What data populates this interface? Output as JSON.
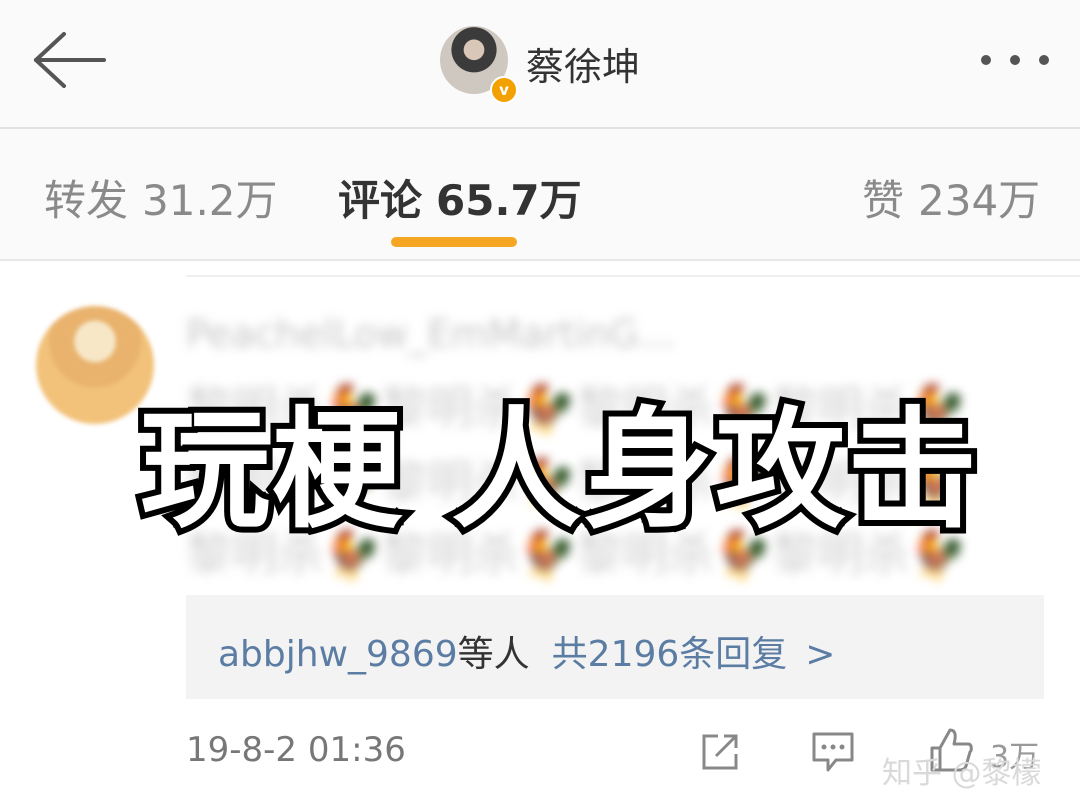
{
  "header": {
    "title": "蔡徐坤",
    "verified_badge": "v",
    "back_icon": "back-arrow-icon",
    "more_icon": "more-dots-icon"
  },
  "tabs": [
    {
      "label": "转发",
      "count": "31.2万"
    },
    {
      "label": "评论",
      "count": "65.7万"
    },
    {
      "label": "赞",
      "count": "234万"
    }
  ],
  "comment": {
    "username": "PeachelLow_EmMartinG...",
    "lines": [
      "黎明杀🐓黎明杀🐓黎明杀🐓黎明杀🐓",
      "黎明杀🐓黎明杀🐓黎明杀🐓黎明杀🐓",
      "黎明杀🐓黎明杀🐓黎明杀🐓黎明杀🐓"
    ],
    "reply_users": "abbjhw_9869",
    "reply_users_suffix": "等人",
    "reply_count": "共2196条回复",
    "reply_chevron": ">",
    "timestamp": "19-8-2 01:36",
    "like_count": "3万"
  },
  "overlay_caption": "玩梗  人身攻击",
  "watermark": "知乎 @黎檬",
  "colors": {
    "accent": "#f5a623",
    "link": "#5b7ca3"
  }
}
